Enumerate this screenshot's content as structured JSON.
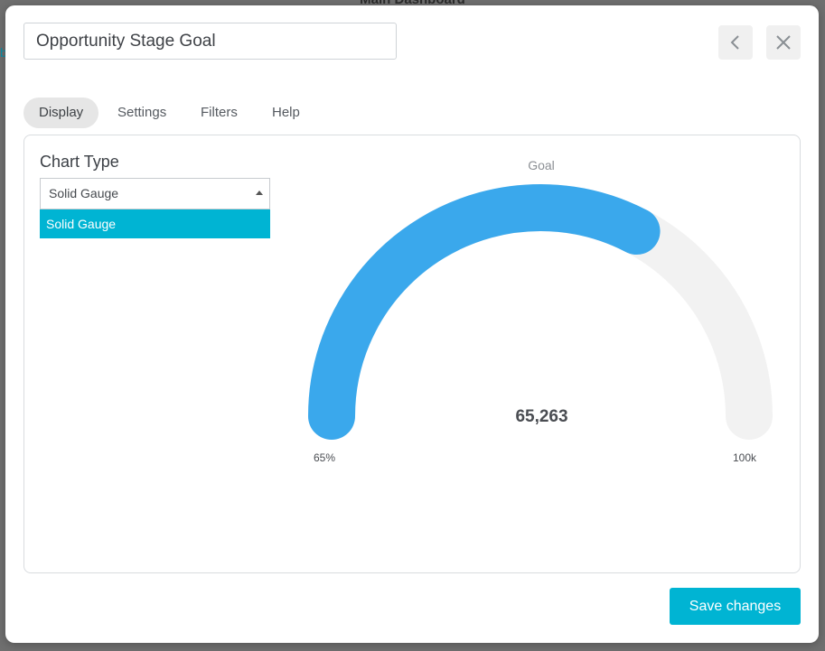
{
  "background": {
    "dashboard_title": "Main Dashboard",
    "partial_letter": "b"
  },
  "modal": {
    "title_value": "Opportunity Stage Goal",
    "back_icon": "chevron-left-icon",
    "close_icon": "close-icon",
    "tabs": [
      {
        "label": "Display",
        "active": true
      },
      {
        "label": "Settings",
        "active": false
      },
      {
        "label": "Filters",
        "active": false
      },
      {
        "label": "Help",
        "active": false
      }
    ],
    "chart_type": {
      "label": "Chart Type",
      "selected": "Solid Gauge",
      "options": [
        "Solid Gauge"
      ]
    },
    "save_label": "Save changes"
  },
  "chart_data": {
    "type": "solid-gauge",
    "title": "Goal",
    "value": 65263,
    "value_label": "65,263",
    "min_label": "65%",
    "max_label": "100k",
    "min": 0,
    "max": 100000,
    "fill_color": "#3aa8ec",
    "track_color": "#f2f2f2"
  },
  "colors": {
    "accent": "#00b4d3",
    "gauge_fill": "#3aa8ec"
  }
}
